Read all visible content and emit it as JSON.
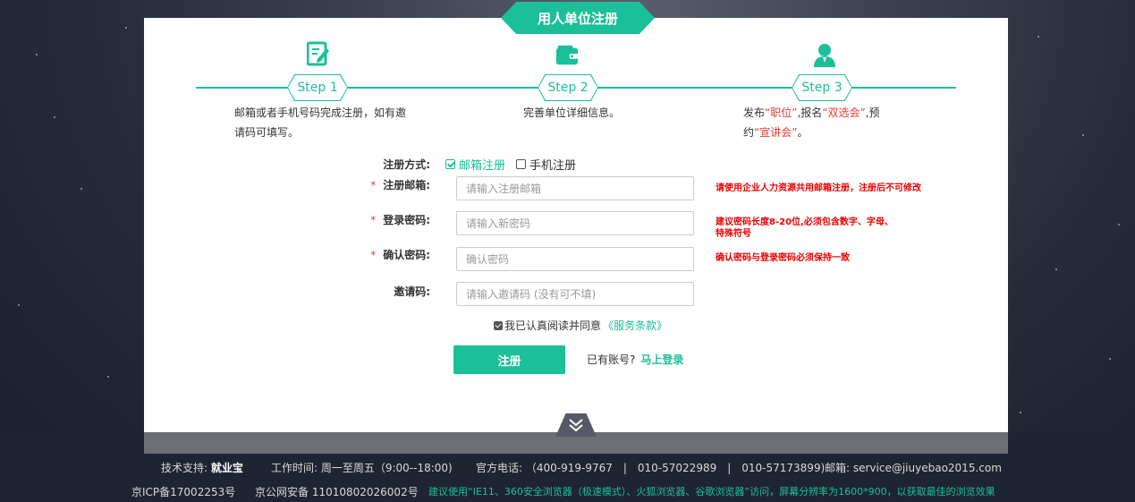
{
  "title": "用人单位注册",
  "steps": [
    {
      "label": "Step 1",
      "icon": "edit-form-icon",
      "desc_line1": "邮箱或者手机号码完成注册，如有邀",
      "desc_line2": "请码可填写。"
    },
    {
      "label": "Step 2",
      "icon": "wallet-icon",
      "desc": "完善单位详细信息。"
    },
    {
      "label": "Step 3",
      "icon": "user-icon",
      "desc_a": "发布",
      "desc_b": "“职位”",
      "desc_c": ",报名",
      "desc_d": "“双选会”",
      "desc_e": ",预",
      "desc_f": "约",
      "desc_g": "“宣讲会”",
      "desc_h": "。"
    }
  ],
  "form": {
    "reg_method_label": "注册方式:",
    "reg_options": [
      "邮箱注册",
      "手机注册"
    ],
    "selected_option": "邮箱注册",
    "required_mark": "*",
    "email": {
      "label": "注册邮箱:",
      "placeholder": "请输入注册邮箱",
      "hint": "请使用企业人力资源共用邮箱注册，注册后不可修改"
    },
    "password": {
      "label": "登录密码:",
      "placeholder": "请输入新密码",
      "hint_line1": "建议密码长度8-20位,必须包含数字、字母、",
      "hint_line2": "特殊符号"
    },
    "confirm": {
      "label": "确认密码:",
      "placeholder": "确认密码",
      "hint": "确认密码与登录密码必须保持一致"
    },
    "invite": {
      "label": "邀请码:",
      "placeholder": "请输入邀请码 (没有可不填)"
    },
    "agree_text": "我已认真阅读并同意",
    "terms_link": "《服务条款》",
    "submit": "注册",
    "has_account": "已有账号?",
    "login_link": "马上登录"
  },
  "footer": {
    "support_label": "技术支持:",
    "support_value": "就业宝",
    "hours": "工作时间: 周一至周五（9:00--18:00)",
    "phone": "官方电话: （400-919-9767　|　010-57022989　|　010-57173899)",
    "email": "邮箱: service@jiuyebao2015.com",
    "icp": "京ICP备17002253号",
    "police": "京公网安备 11010802026002号",
    "browser_tip": "建议使用“IE11、360安全浏览器（极速模式）、火狐浏览器、谷歌浏览器”访问，屏幕分辨率为1600*900，以获取最佳的浏览效果"
  },
  "colors": {
    "accent": "#1bbf98",
    "error": "#e53935"
  }
}
